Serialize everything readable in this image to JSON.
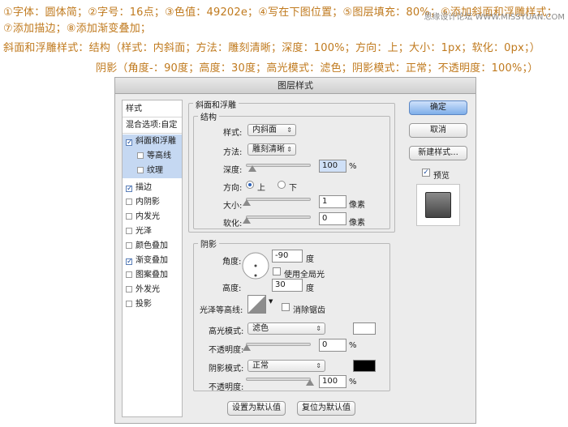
{
  "instructions": {
    "line1": "①字体：圆体简；②字号：16点；③色值：49202e；④写在下图位置；⑤图层填充：80%；⑥添加斜面和浮雕样式；",
    "line2": "⑦添加描边；⑧添加渐变叠加；",
    "line3": "斜面和浮雕样式：结构（样式：内斜面；方法：雕刻清晰；深度：100%；方向：上；大小：1px；软化：0px；）",
    "line4": "阴影（角度-：90度；高度：30度；高光模式：滤色；阴影模式：正常；不透明度：100%；）",
    "watermark": "思缘设计论坛 WWW.MISSYUAN.COM"
  },
  "dialog": {
    "title": "图层样式",
    "styles_list": {
      "header": "样式",
      "blend_options": "混合选项:自定",
      "items": [
        {
          "label": "斜面和浮雕",
          "checked": true
        },
        {
          "label": "等高线",
          "checked": false
        },
        {
          "label": "纹理",
          "checked": false
        },
        {
          "label": "描边",
          "checked": true
        },
        {
          "label": "内阴影",
          "checked": false
        },
        {
          "label": "内发光",
          "checked": false
        },
        {
          "label": "光泽",
          "checked": false
        },
        {
          "label": "颜色叠加",
          "checked": false
        },
        {
          "label": "渐变叠加",
          "checked": true
        },
        {
          "label": "图案叠加",
          "checked": false
        },
        {
          "label": "外发光",
          "checked": false
        },
        {
          "label": "投影",
          "checked": false
        }
      ]
    },
    "bevel": {
      "group_title": "斜面和浮雕",
      "structure_title": "结构",
      "style_label": "样式:",
      "style_value": "内斜面",
      "technique_label": "方法:",
      "technique_value": "雕刻清晰",
      "depth_label": "深度:",
      "depth_value": "100",
      "depth_unit": "%",
      "direction_label": "方向:",
      "direction_up": "上",
      "direction_down": "下",
      "size_label": "大小:",
      "size_value": "1",
      "size_unit": "像素",
      "soften_label": "软化:",
      "soften_value": "0",
      "soften_unit": "像素"
    },
    "shading": {
      "title": "阴影",
      "angle_label": "角度:",
      "angle_value": "-90",
      "angle_unit": "度",
      "global_light_label": "使用全局光",
      "altitude_label": "高度:",
      "altitude_value": "30",
      "altitude_unit": "度",
      "gloss_label": "光泽等高线:",
      "antialias_label": "消除锯齿",
      "highlight_mode_label": "高光模式:",
      "highlight_mode_value": "滤色",
      "highlight_opacity_label": "不透明度:",
      "highlight_opacity_value": "0",
      "shadow_mode_label": "阴影模式:",
      "shadow_mode_value": "正常",
      "shadow_opacity_label": "不透明度:",
      "shadow_opacity_value": "100",
      "percent_unit": "%",
      "highlight_color": "#ffffff",
      "shadow_color": "#000000"
    },
    "buttons": {
      "ok": "确定",
      "cancel": "取消",
      "new_style": "新建样式...",
      "preview": "预览",
      "make_default": "设置为默认值",
      "reset_default": "复位为默认值"
    }
  }
}
